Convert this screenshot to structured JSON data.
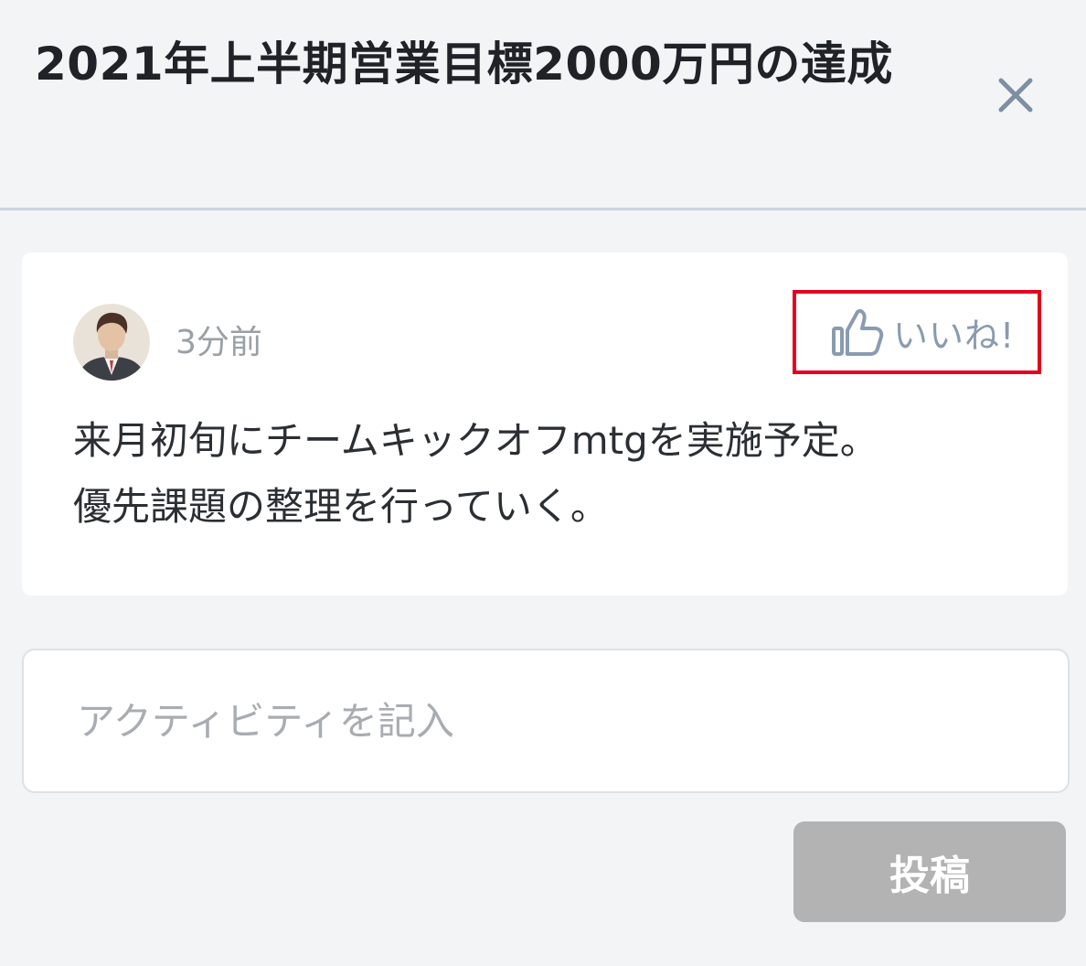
{
  "header": {
    "title": "2021年上半期営業目標2000万円の達成",
    "close_icon": "close-icon"
  },
  "comment": {
    "avatar_icon": "user-avatar",
    "timestamp": "3分前",
    "like": {
      "icon": "thumbs-up-icon",
      "label": "いいね!"
    },
    "body_lines": [
      "来月初旬にチームキックオフmtgを実施予定。",
      "優先課題の整理を行っていく。"
    ]
  },
  "activity_input": {
    "value": "",
    "placeholder": "アクティビティを記入"
  },
  "post_button": {
    "label": "投稿"
  },
  "colors": {
    "background": "#f3f4f6",
    "card": "#ffffff",
    "highlight_border": "#e6001f",
    "like_text": "#8a9bb0",
    "post_button_disabled": "#b3b3b3"
  }
}
